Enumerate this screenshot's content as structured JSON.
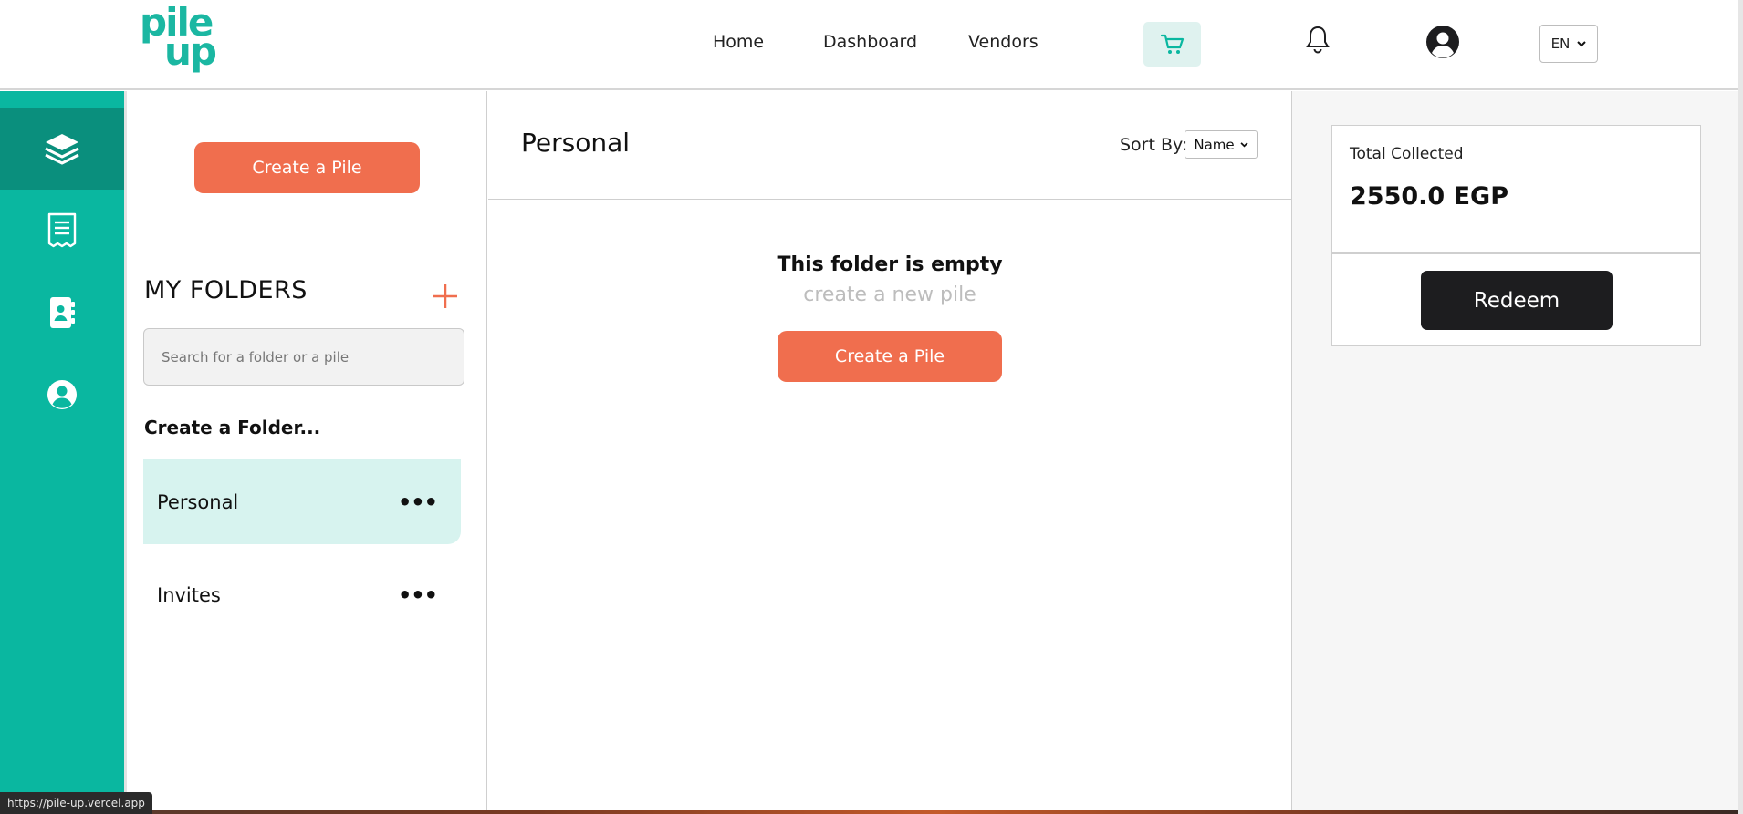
{
  "header": {
    "logo_line1": "pile",
    "logo_line2": "up",
    "nav": [
      "Home",
      "Dashboard",
      "Vendors"
    ],
    "language": "EN",
    "icons": [
      "cart-icon",
      "bell-icon",
      "user-icon",
      "chevron-down-icon"
    ]
  },
  "sidebar": {
    "items": [
      {
        "name": "layers",
        "icon": "layers-icon",
        "active": true
      },
      {
        "name": "receipt",
        "icon": "receipt-icon",
        "active": false
      },
      {
        "name": "contacts",
        "icon": "contact-book-icon",
        "active": false
      },
      {
        "name": "profile",
        "icon": "user-circle-icon",
        "active": false
      }
    ]
  },
  "folders": {
    "create_button": "Create a Pile",
    "heading": "MY FOLDERS",
    "search_placeholder": "Search for a folder or a pile",
    "create_folder": "Create a Folder...",
    "items": [
      {
        "label": "Personal",
        "active": true
      },
      {
        "label": "Invites",
        "active": false
      }
    ]
  },
  "main": {
    "title": "Personal",
    "sort_label": "Sort By:",
    "sort_value": "Name",
    "empty_title": "This folder is empty",
    "empty_sub": "create a new pile",
    "create_button": "Create a Pile"
  },
  "summary": {
    "total_label": "Total Collected",
    "total_value": "2550.0 EGP",
    "redeem_button": "Redeem"
  },
  "status_url": "https://pile-up.vercel.app",
  "colors": {
    "teal": "#0ab7a0",
    "teal_dark": "#0a8f7d",
    "orange": "#f06e4e",
    "dark": "#1d1d1f"
  }
}
